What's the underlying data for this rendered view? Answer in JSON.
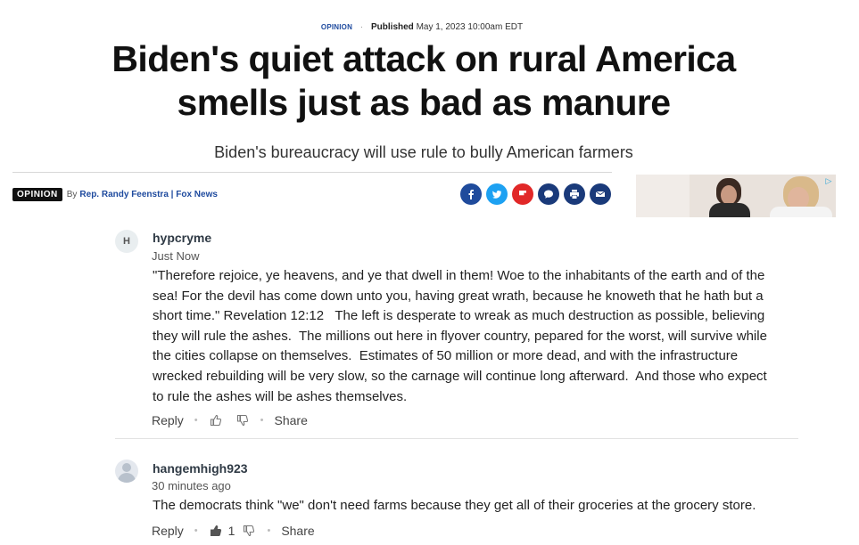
{
  "article": {
    "kicker": "OPINION",
    "published_label": "Published",
    "published_date": "May 1, 2023 10:00am EDT",
    "headline": "Biden's quiet attack on rural America smells just as bad as manure",
    "subheadline": "Biden's bureaucracy will use rule to bully American farmers",
    "byline": {
      "tag": "OPINION",
      "by": "By",
      "author": "Rep. Randy Feenstra | Fox News"
    },
    "share_icons": [
      "facebook-icon",
      "twitter-icon",
      "flipboard-icon",
      "comment-icon",
      "print-icon",
      "email-icon"
    ]
  },
  "comments": [
    {
      "avatar_letter": "H",
      "username": "hypcryme",
      "time": "Just Now",
      "body": "\"Therefore rejoice, ye heavens, and ye that dwell in them! Woe to the inhabitants of the earth and of the sea! For the devil has come down unto you, having great wrath, because he knoweth that he hath but a short time.\" Revelation 12:12   The left is desperate to wreak as much destruction as possible, believing they will rule the ashes.  The millions out here in flyover country, pepared for the worst, will survive while the cities collapse on themselves.  Estimates of 50 million or more dead, and with the infrastructure wrecked rebuilding will be very slow, so the carnage will continue long afterward.  And those who expect to rule the ashes will be ashes themselves.",
      "reply_label": "Reply",
      "like_count": "",
      "share_label": "Share"
    },
    {
      "avatar_letter": "",
      "username": "hangemhigh923",
      "time": "30 minutes ago",
      "body": "The democrats think \"we\" don't need farms because they get all of their groceries at the grocery store.",
      "reply_label": "Reply",
      "like_count": "1",
      "share_label": "Share"
    }
  ]
}
